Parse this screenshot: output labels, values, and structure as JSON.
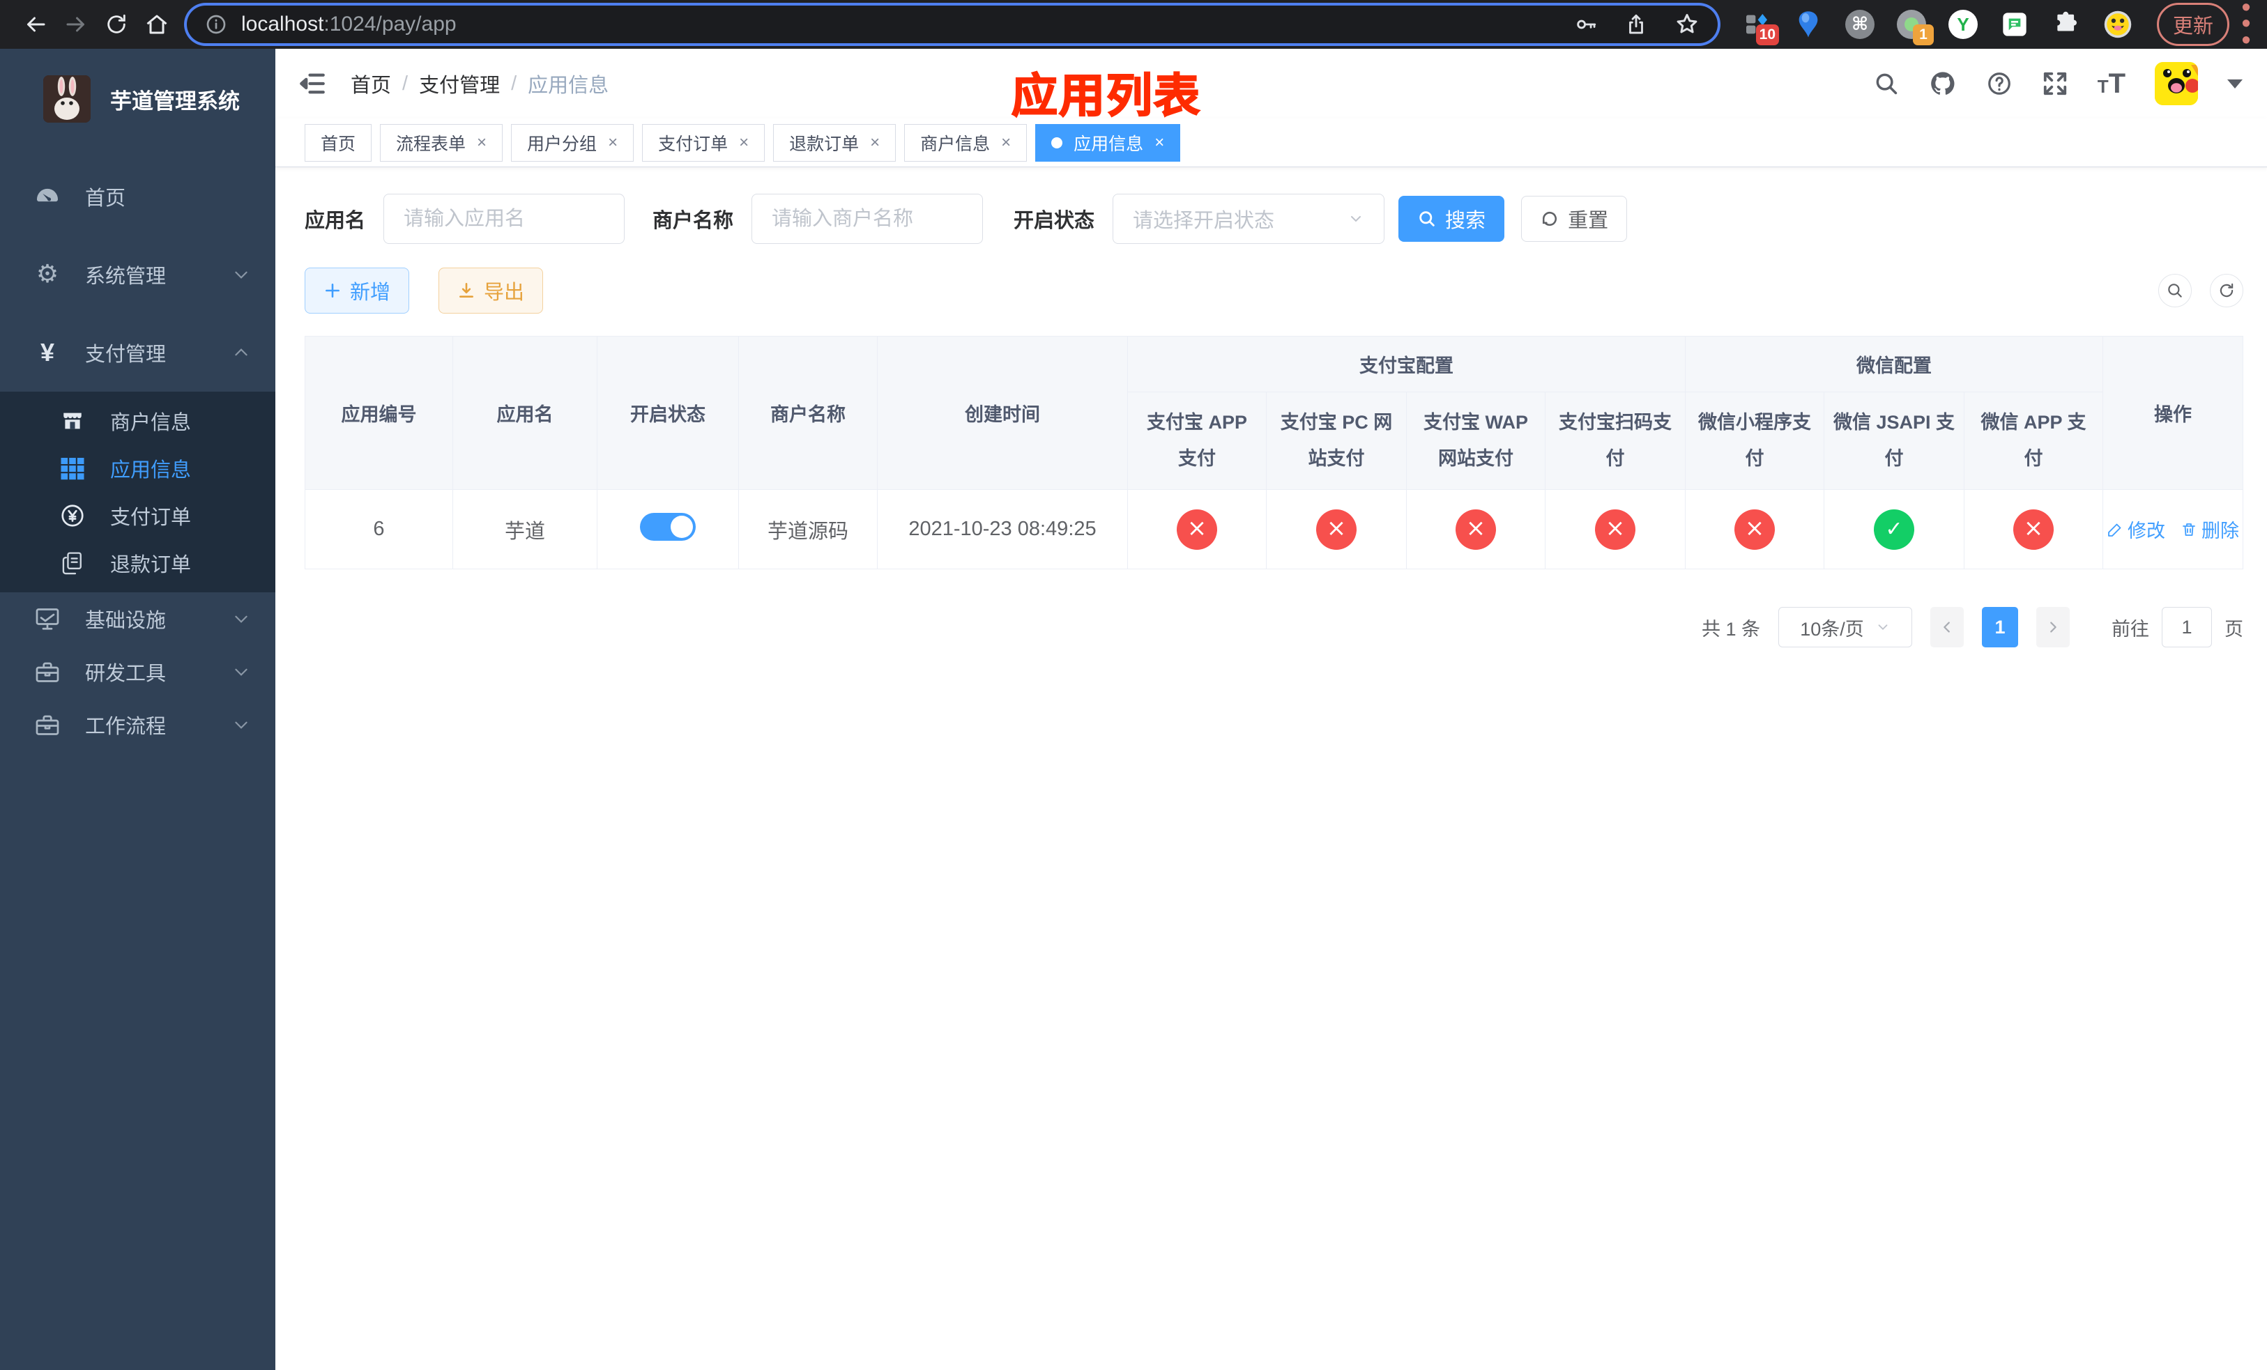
{
  "colors": {
    "accent": "#409eff",
    "danger": "#f7504d",
    "success": "#13ce66",
    "warning": "#e6a23c",
    "sidebar_bg": "#304156",
    "submenu_bg": "#1f2d3d",
    "annotation_red": "#fe2b01"
  },
  "browser": {
    "url_host": "localhost",
    "url_rest": ":1024/pay/app",
    "update_label": "更新",
    "ext_badge_primary": "10",
    "ext_badge_secondary": "1",
    "command_glyph": "⌘",
    "y_glyph": "Y",
    "dots_glyph": "⋮"
  },
  "sidebar": {
    "title": "芋道管理系统",
    "home": "首页",
    "system": "系统管理",
    "payment": "支付管理",
    "sub_merchant": "商户信息",
    "sub_app": "应用信息",
    "sub_pay_order": "支付订单",
    "sub_refund_order": "退款订单",
    "infra": "基础设施",
    "devtools": "研发工具",
    "workflow": "工作流程"
  },
  "header": {
    "breadcrumb": [
      "首页",
      "支付管理",
      "应用信息"
    ],
    "separator": "/",
    "annotation": "应用列表"
  },
  "tabs": [
    {
      "label": "首页"
    },
    {
      "label": "流程表单"
    },
    {
      "label": "用户分组"
    },
    {
      "label": "支付订单"
    },
    {
      "label": "退款订单"
    },
    {
      "label": "商户信息"
    },
    {
      "label": "应用信息"
    }
  ],
  "filters": {
    "app_name_label": "应用名",
    "app_name_placeholder": "请输入应用名",
    "merchant_label": "商户名称",
    "merchant_placeholder": "请输入商户名称",
    "status_label": "开启状态",
    "status_placeholder": "请选择开启状态",
    "search_label": "搜索",
    "reset_label": "重置"
  },
  "toolbar": {
    "add_label": "新增",
    "export_label": "导出"
  },
  "table": {
    "group_alipay": "支付宝配置",
    "group_wechat": "微信配置",
    "columns": [
      "应用编号",
      "应用名",
      "开启状态",
      "商户名称",
      "创建时间",
      "支付宝 APP 支付",
      "支付宝 PC 网站支付",
      "支付宝 WAP 网站支付",
      "支付宝扫码支付",
      "微信小程序支付",
      "微信 JSAPI 支付",
      "微信 APP 支付",
      "操作"
    ],
    "row": {
      "id": "6",
      "name": "芋道",
      "enabled": true,
      "merchant": "芋道源码",
      "created_at": "2021-10-23 08:49:25",
      "statuses": [
        "disabled",
        "disabled",
        "disabled",
        "disabled",
        "disabled",
        "enabled",
        "disabled"
      ],
      "edit_label": "修改",
      "delete_label": "删除"
    }
  },
  "pagination": {
    "total_text": "共 1 条",
    "page_size": "10条/页",
    "current_page": "1",
    "goto_label": "前往",
    "goto_value": "1",
    "page_unit": "页"
  }
}
